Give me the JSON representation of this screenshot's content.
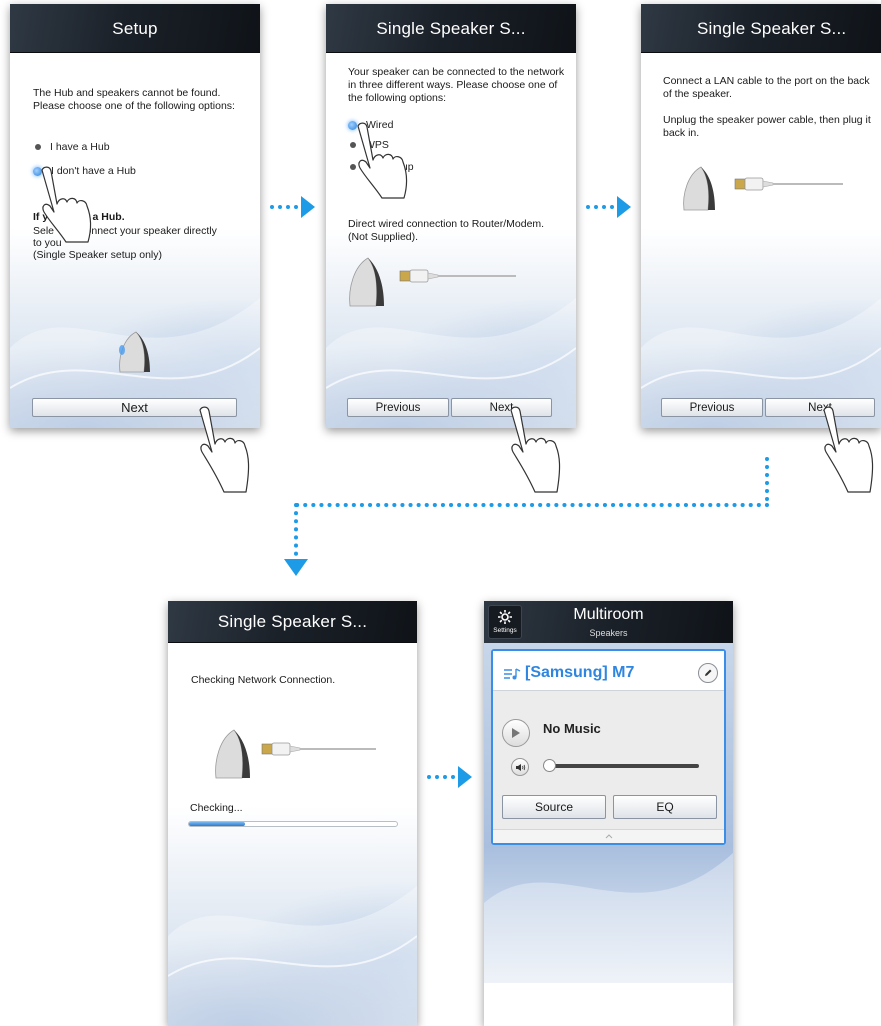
{
  "screens": {
    "setup": {
      "title": "Setup",
      "message": "The Hub and speakers cannot be found. Please choose one of the following options:",
      "options": [
        {
          "label": "I have a Hub",
          "selected": false
        },
        {
          "label": "I don't have a Hub",
          "selected": true
        }
      ],
      "info_heading": "If y      have a Hub.",
      "info_body_1": "Sele         connect your speaker directly",
      "info_body_2": "to you",
      "info_body_3": "(Single Speaker setup only)",
      "next_label": "Next"
    },
    "single_speaker_wired": {
      "title": "Single Speaker S...",
      "message": "Your speaker can be connected to the network in three different ways. Please choose one of the following options:",
      "options": [
        {
          "label": "Wired",
          "selected": true
        },
        {
          "label": "WPS",
          "selected": false
        },
        {
          "label": "tup",
          "selected": false
        }
      ],
      "description": "Direct wired connection to Router/Modem. (Not Supplied).",
      "previous_label": "Previous",
      "next_label": "Next"
    },
    "single_speaker_lan": {
      "title": "Single Speaker S...",
      "message_1": "Connect a LAN cable to the port on the back of the speaker.",
      "message_2": "Unplug the speaker power cable, then plug it back in.",
      "previous_label": "Previous",
      "next_label": "Next"
    },
    "single_speaker_checking": {
      "title": "Single Speaker S...",
      "message": "Checking Network Connection.",
      "status": "Checking...",
      "progress": 0.27
    },
    "multiroom": {
      "title": "Multiroom",
      "subtitle": "Speakers",
      "settings_label": "Settings",
      "speaker_name": "[Samsung] M7",
      "now_playing": "No Music",
      "volume": 0.0,
      "source_label": "Source",
      "eq_label": "EQ"
    }
  },
  "colors": {
    "accent": "#1e9be6",
    "selected_border": "#3a8ee8",
    "title_bar": "#1b2129"
  },
  "icons": [
    "finger-tap-icon",
    "speaker-icon",
    "lan-cable-icon",
    "settings-gear-icon",
    "play-icon",
    "volume-icon",
    "edit-pencil-icon",
    "music-note-icon"
  ]
}
